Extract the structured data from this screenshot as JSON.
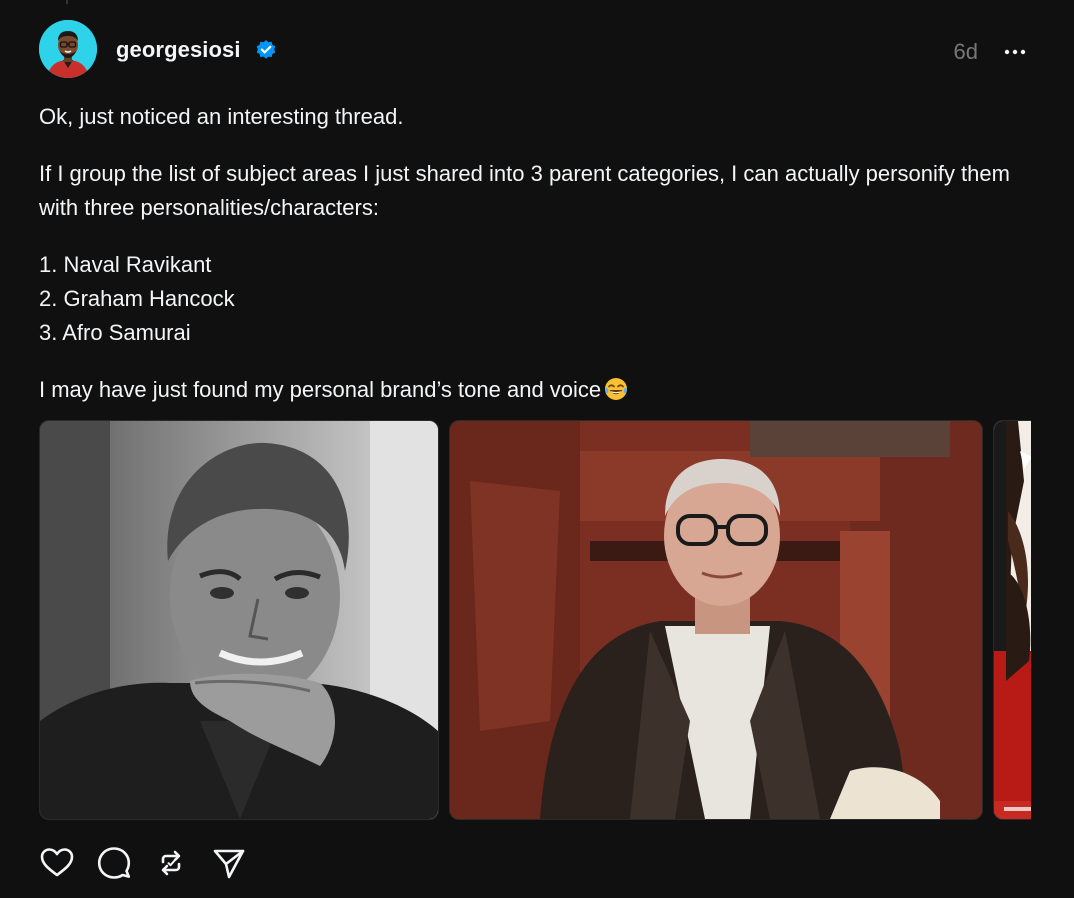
{
  "post": {
    "author": {
      "username": "georgesiosi",
      "verified": true,
      "avatar_icon": "avatar-man-glasses"
    },
    "timestamp": "6d",
    "text": {
      "line1": "Ok, just noticed an interesting thread.",
      "line2": "If I group the list of subject areas I just shared into 3 parent categories, I can actually personify them with three personalities/characters:",
      "list": [
        "1. Naval Ravikant",
        "2. Graham Hancock",
        "3. Afro Samurai"
      ],
      "line4": "I may have just found my personal brand’s tone and voice",
      "emoji": "face-with-tears-of-joy-icon"
    },
    "media": [
      {
        "icon": "photo-bw-portrait-man-hand-on-chin"
      },
      {
        "icon": "photo-man-glasses-leather-jacket-stone-doorway"
      },
      {
        "icon": "photo-anime-illustration-partial"
      }
    ],
    "actions": [
      "like-icon",
      "comment-icon",
      "repost-icon",
      "share-icon"
    ]
  },
  "colors": {
    "background": "#101010",
    "text": "#f3f5f7",
    "muted": "#777777",
    "verified": "#0095f6"
  }
}
